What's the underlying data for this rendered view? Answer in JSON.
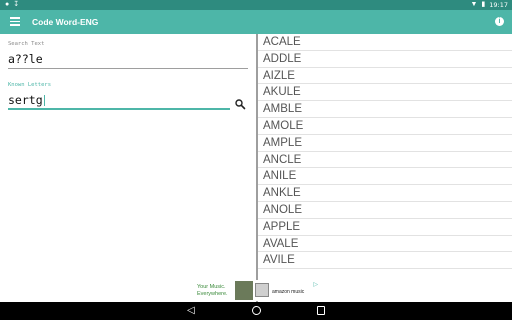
{
  "status_bar": {
    "time": "19:17",
    "left_icons": [
      "notification-icon",
      "download-icon"
    ],
    "right_icons": [
      "wifi-icon",
      "battery-icon"
    ]
  },
  "app_bar": {
    "title": "Code Word-ENG",
    "menu_icon": "menu-icon",
    "info_icon": "info-icon"
  },
  "search": {
    "label": "Search Text",
    "value": "a??le"
  },
  "known": {
    "label": "Known Letters",
    "value": "sertg"
  },
  "results": {
    "words": [
      "ACALE",
      "ADDLE",
      "AIZLE",
      "AKULE",
      "AMBLE",
      "AMOLE",
      "AMPLE",
      "ANCLE",
      "ANILE",
      "ANKLE",
      "ANOLE",
      "APPLE",
      "AVALE",
      "AVILE"
    ]
  },
  "ad": {
    "line1": "Your Music.",
    "line2": "Everywhere.",
    "brand": "amazon music"
  },
  "colors": {
    "accent": "#4db6a8",
    "status_bar": "#2e8b7f",
    "nav_bar": "#000000"
  }
}
